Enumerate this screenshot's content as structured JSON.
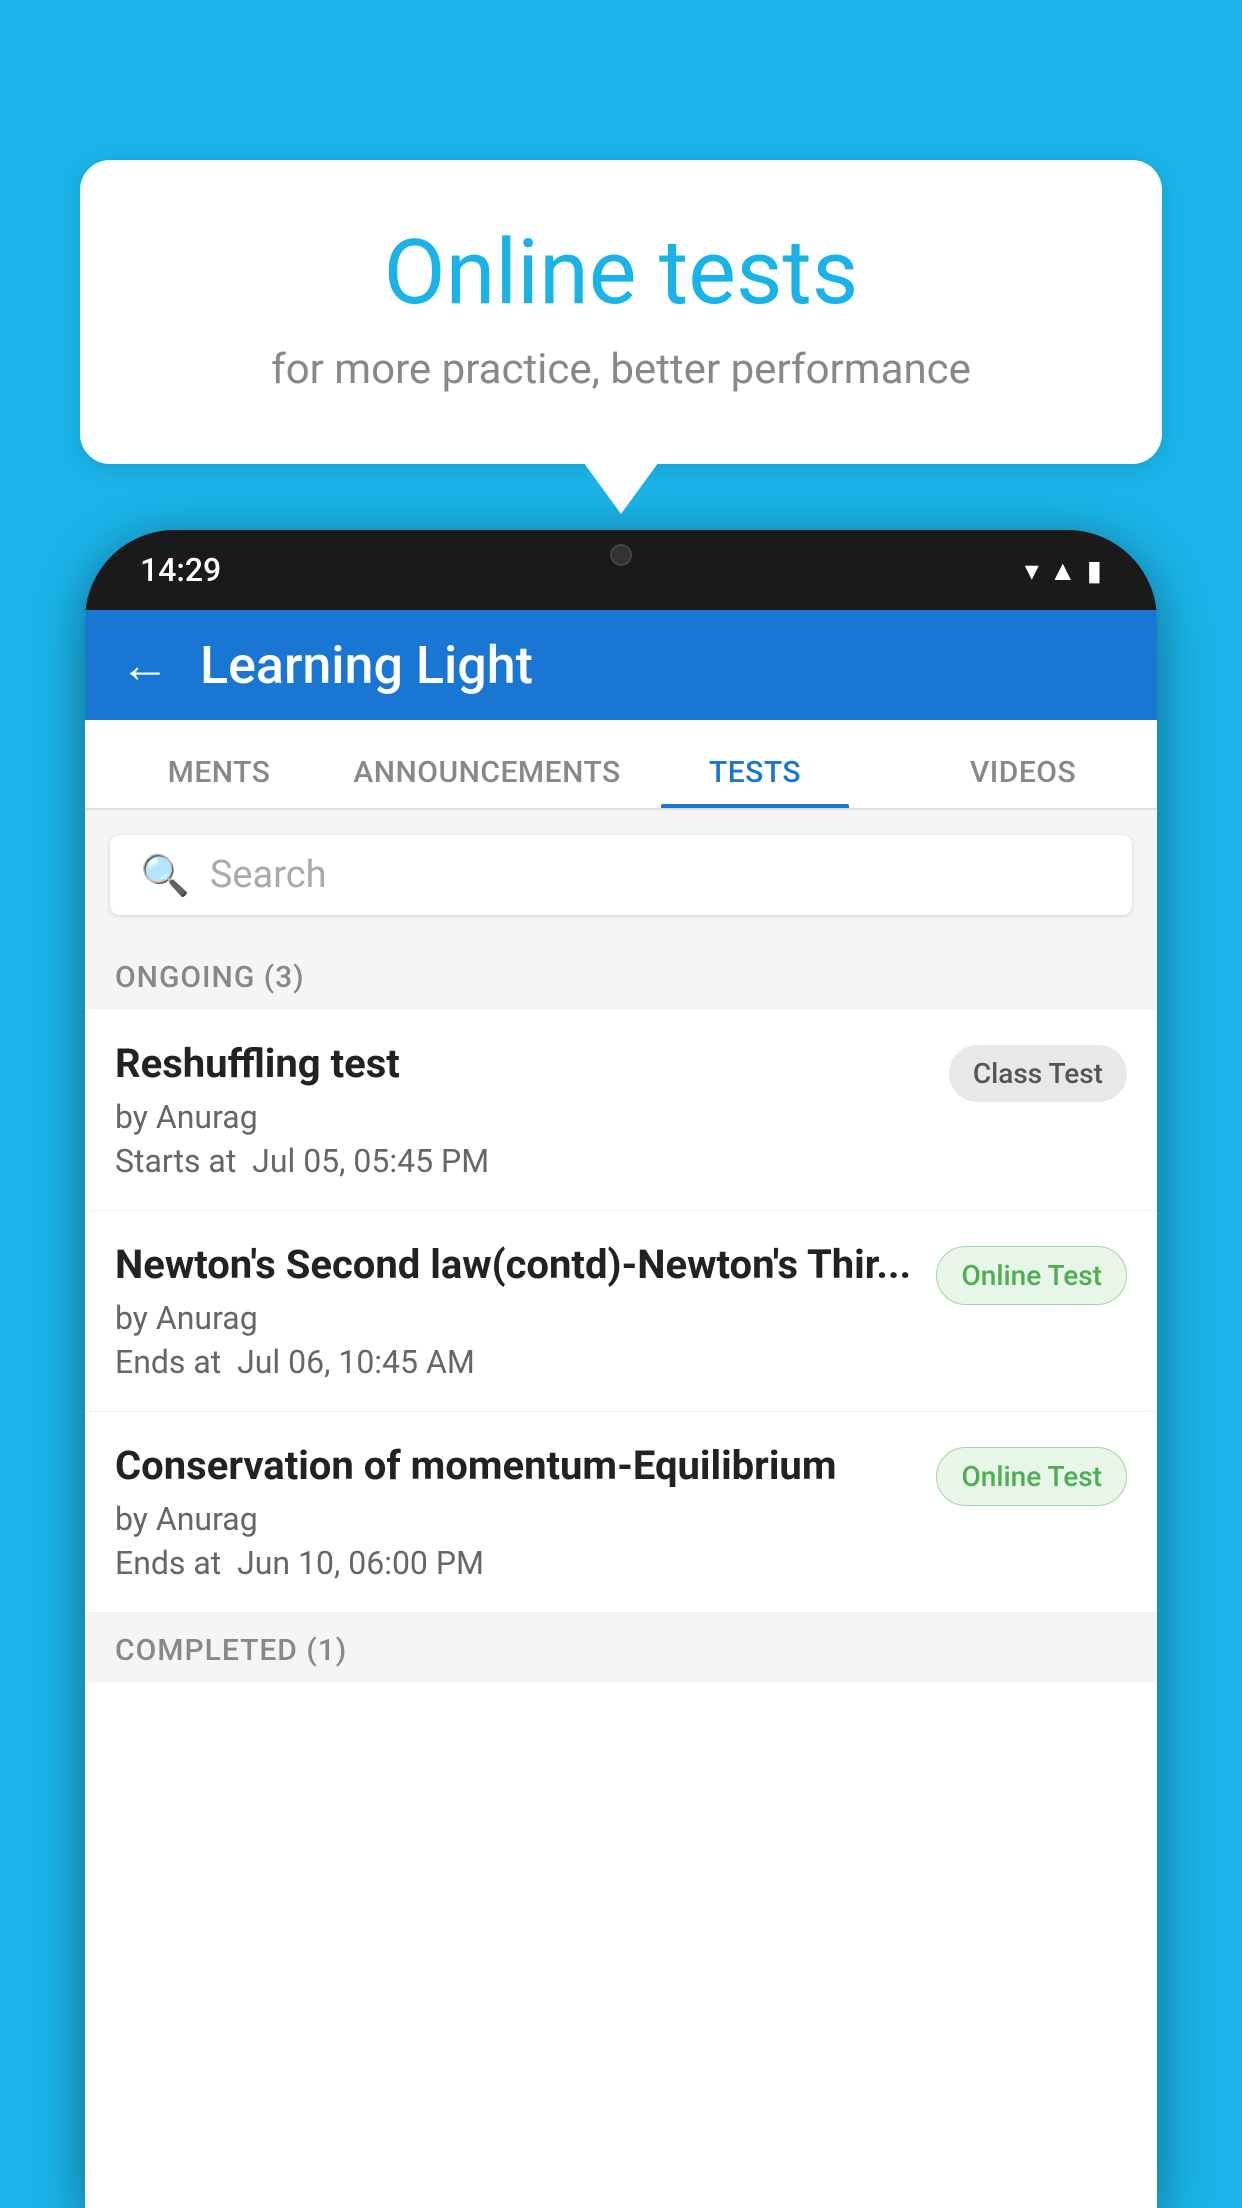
{
  "background_color": "#1ab3e8",
  "bubble": {
    "title": "Online tests",
    "subtitle": "for more practice, better performance"
  },
  "phone": {
    "time": "14:29",
    "status_icons": [
      "wifi",
      "signal",
      "battery"
    ]
  },
  "app": {
    "header": {
      "back_label": "←",
      "title": "Learning Light"
    },
    "tabs": [
      {
        "label": "MENTS",
        "active": false
      },
      {
        "label": "ANNOUNCEMENTS",
        "active": false
      },
      {
        "label": "TESTS",
        "active": true
      },
      {
        "label": "VIDEOS",
        "active": false
      }
    ],
    "search": {
      "placeholder": "Search"
    },
    "sections": [
      {
        "label": "ONGOING (3)",
        "tests": [
          {
            "name": "Reshuffling test",
            "author": "by Anurag",
            "time_label": "Starts at",
            "time": "Jul 05, 05:45 PM",
            "badge": "Class Test",
            "badge_type": "class"
          },
          {
            "name": "Newton's Second law(contd)-Newton's Thir...",
            "author": "by Anurag",
            "time_label": "Ends at",
            "time": "Jul 06, 10:45 AM",
            "badge": "Online Test",
            "badge_type": "online"
          },
          {
            "name": "Conservation of momentum-Equilibrium",
            "author": "by Anurag",
            "time_label": "Ends at",
            "time": "Jun 10, 06:00 PM",
            "badge": "Online Test",
            "badge_type": "online"
          }
        ]
      }
    ],
    "completed_label": "COMPLETED (1)"
  }
}
